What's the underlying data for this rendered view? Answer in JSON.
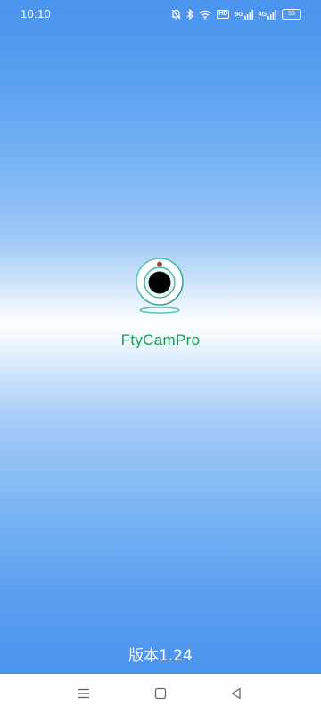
{
  "status_bar": {
    "time": "10:10",
    "network_hd": "HD",
    "signal_1": "5G",
    "signal_2": "4G",
    "battery": "56"
  },
  "splash": {
    "app_name": "FtyCamPro",
    "version": "版本1.24",
    "logo_icon": "webcam-icon"
  },
  "nav_bar": {
    "menu_icon": "menu-icon",
    "home_icon": "home-square-icon",
    "back_icon": "back-triangle-icon"
  },
  "colors": {
    "gradient_blue": "#4a93ee",
    "app_name_green": "#1e9a4e",
    "logo_teal": "#3bb7a0"
  }
}
